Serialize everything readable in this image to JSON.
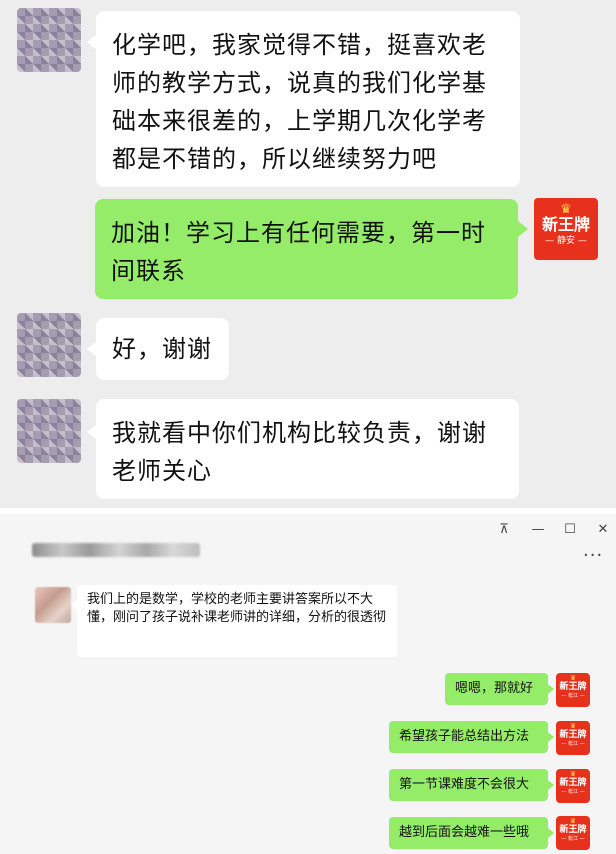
{
  "top_chat": {
    "messages": [
      {
        "side": "left",
        "text": "化学吧，我家觉得不错，挺喜欢老师的教学方式，说真的我们化学基础本来很差的，上学期几次化学考都是不错的，所以继续努力吧"
      },
      {
        "side": "right",
        "text": "加油！学习上有任何需要，第一时间联系"
      },
      {
        "side": "left",
        "text": "好，谢谢"
      },
      {
        "side": "left",
        "text": "我就看中你们机构比较负责，谢谢老师关心"
      }
    ],
    "brand_avatar": {
      "crown": "♛",
      "name": "新王牌",
      "sub": "— 静安 —"
    }
  },
  "window": {
    "controls": {
      "pin": "⊼",
      "minimize": "—",
      "maximize": "☐",
      "close": "✕"
    },
    "more": "···",
    "messages": [
      {
        "side": "left",
        "text": "我们上的是数学，学校的老师主要讲答案所以不大懂，刚问了孩子说补课老师讲的详细，分析的很透彻"
      },
      {
        "side": "right",
        "text": "嗯嗯，那就好"
      },
      {
        "side": "right",
        "text": "希望孩子能总结出方法"
      },
      {
        "side": "right",
        "text": "第一节课难度不会很大"
      },
      {
        "side": "right",
        "text": "越到后面会越难一些哦"
      }
    ],
    "brand_avatar": {
      "crown": "♛",
      "name": "新王牌",
      "sub": "— 松江 —"
    }
  },
  "colors": {
    "green_bubble": "#95ec69",
    "brand_red": "#e8311c",
    "chat_bg": "#ededed"
  }
}
